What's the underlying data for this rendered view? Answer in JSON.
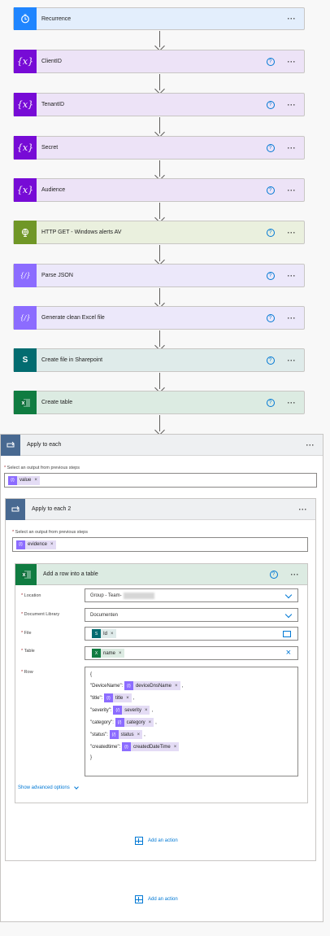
{
  "steps": [
    {
      "title": "Recurrence",
      "icon": "clock-icon",
      "help": false
    },
    {
      "title": "ClientID",
      "icon": "variable-icon",
      "help": true
    },
    {
      "title": "TenantID",
      "icon": "variable-icon",
      "help": true
    },
    {
      "title": "Secret",
      "icon": "variable-icon",
      "help": true
    },
    {
      "title": "Audience",
      "icon": "variable-icon",
      "help": true
    },
    {
      "title": "HTTP GET - Windows alerts AV",
      "icon": "globe-icon",
      "help": true
    },
    {
      "title": "Parse JSON",
      "icon": "data-operation-icon",
      "help": true
    },
    {
      "title": "Generate clean Excel file",
      "icon": "data-operation-icon",
      "help": true
    },
    {
      "title": "Create file in Sharepoint",
      "icon": "sharepoint-icon",
      "help": true
    },
    {
      "title": "Create table",
      "icon": "excel-icon",
      "help": true
    }
  ],
  "apply_each": {
    "title": "Apply to each",
    "select_label": "Select an output from previous steps",
    "token": "value"
  },
  "apply_each2": {
    "title": "Apply to each 2",
    "select_label": "Select an output from previous steps",
    "token": "evidence"
  },
  "add_row": {
    "title": "Add a row into a table",
    "location_label": "Location",
    "location_value": "Group - Team-",
    "library_label": "Document Library",
    "library_value": "Documenten",
    "file_label": "File",
    "file_token": "Id",
    "table_label": "Table",
    "table_token": "name",
    "row_label": "Row",
    "row_open": "{",
    "row_close": "}",
    "row_lines": [
      {
        "key": "\"DeviceName\":",
        "token": "deviceDnsName"
      },
      {
        "key": "\"title\":",
        "token": "title"
      },
      {
        "key": "\"severity\":",
        "token": "severity"
      },
      {
        "key": "\"category\":",
        "token": "category"
      },
      {
        "key": "\"status\":",
        "token": "status"
      },
      {
        "key": "\"createdtime\":",
        "token": "createdDateTime"
      }
    ],
    "advanced": "Show advanced options"
  },
  "add_action_inner": "Add an action",
  "add_action_outer": "Add an action",
  "more_glyph": "···",
  "help_glyph": "?",
  "close_glyph": "×",
  "comma": ",",
  "required_mark": "*"
}
